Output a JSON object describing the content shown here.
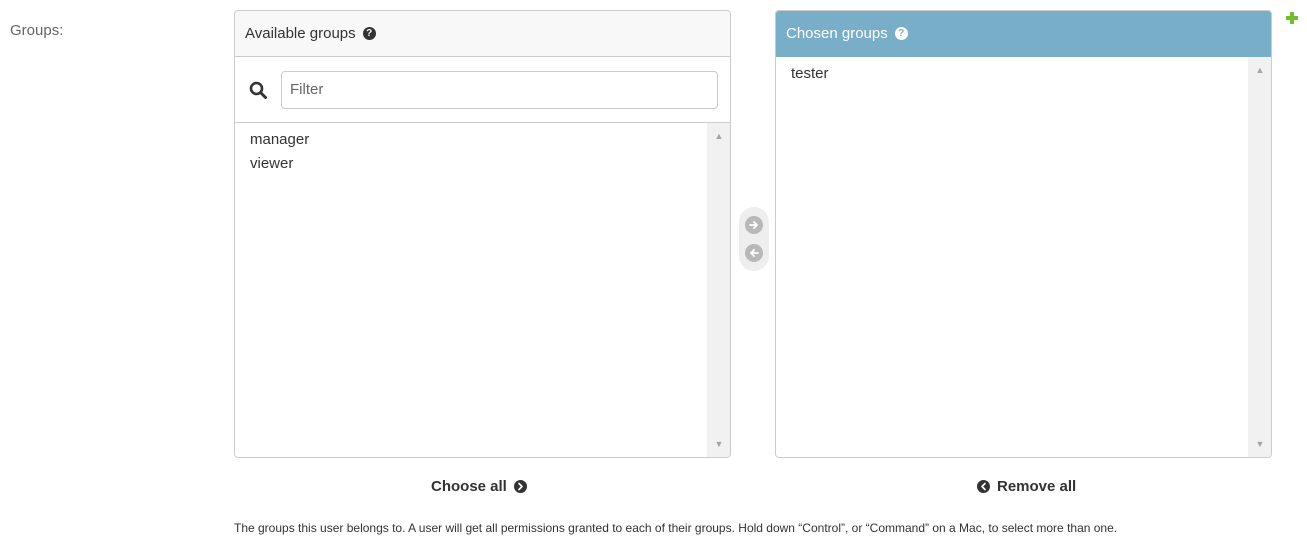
{
  "field": {
    "label": "Groups:"
  },
  "available": {
    "title": "Available groups",
    "help_icon": "question-circle-icon",
    "filter_placeholder": "Filter",
    "filter_value": "",
    "items": [
      "manager",
      "viewer"
    ]
  },
  "chosen": {
    "title": "Chosen groups",
    "help_icon": "question-circle-icon",
    "items": [
      "tester"
    ]
  },
  "controls": {
    "add_icon": "arrow-right-circle-icon",
    "remove_icon": "arrow-left-circle-icon"
  },
  "links": {
    "choose_all": "Choose all",
    "remove_all": "Remove all"
  },
  "help_text": "The groups this user belongs to. A user will get all permissions granted to each of their groups. Hold down “Control”, or “Command” on a Mac, to select more than one.",
  "add_related_icon": "plus-icon",
  "colors": {
    "chosen_header": "#79aec8",
    "add_related": "#70bf2b",
    "text": "#333333",
    "border": "#cccccc"
  }
}
